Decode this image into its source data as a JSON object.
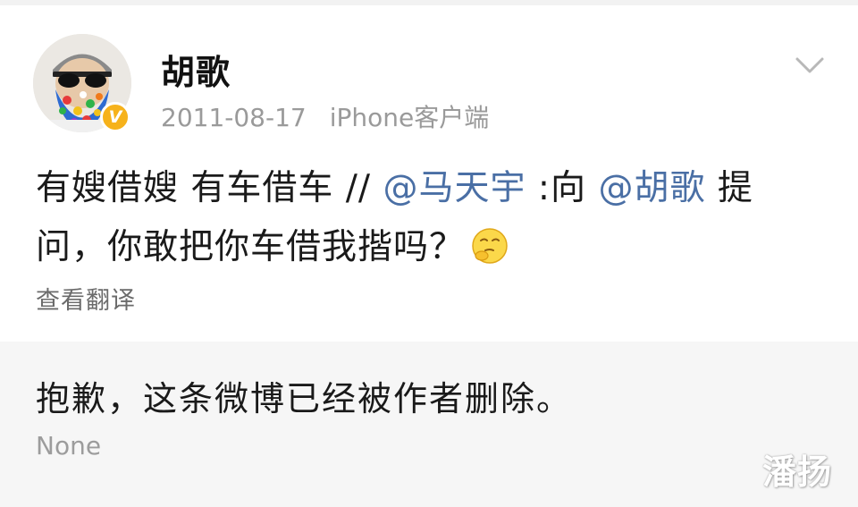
{
  "post": {
    "author": "胡歌",
    "date": "2011-08-17",
    "client": "iPhone客户端",
    "verified_badge": "V",
    "text_part1": "有嫂借嫂 有车借车 // ",
    "mention1": "@马天宇",
    "text_part2": " :向 ",
    "mention2": "@胡歌",
    "text_part3": " 提问，你敢把你车借我揩吗？",
    "emoji": "thinking-face-emoji",
    "translate_label": "查看翻译"
  },
  "retweet": {
    "deleted_message": "抱歉，这条微博已经被作者删除。",
    "source_label": "None"
  },
  "watermark": "潘扬",
  "colors": {
    "mention": "#4a6fa5",
    "badge": "#f6b21b",
    "meta": "#9a9a9a",
    "deleted_bg": "#f6f6f6"
  }
}
